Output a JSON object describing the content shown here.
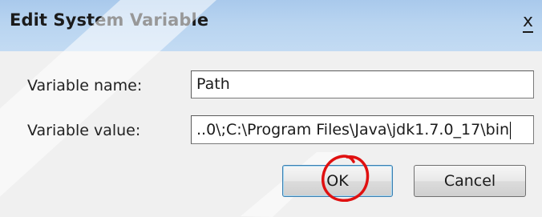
{
  "dialog": {
    "title": "Edit System Variable",
    "close_label": "x"
  },
  "form": {
    "name_label": "Variable name:",
    "name_value": "Path",
    "value_label": "Variable value:",
    "value_value": "..0\\;C:\\Program Files\\Java\\jdk1.7.0_17\\bin"
  },
  "buttons": {
    "ok_label": "OK",
    "cancel_label": "Cancel"
  },
  "colors": {
    "title_bar": "#b8d4f0",
    "dialog_background": "#f0f0f0",
    "annotation_circle": "#e01010"
  },
  "annotations": {
    "ok_circle": "red hand-drawn circle around OK button"
  }
}
